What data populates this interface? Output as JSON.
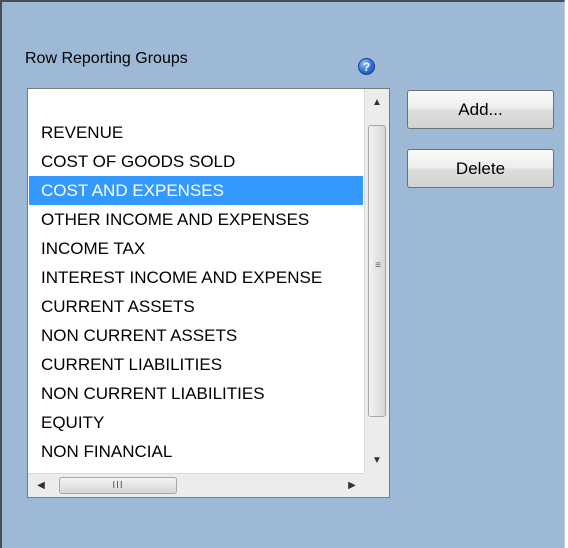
{
  "section": {
    "label": "Row Reporting Groups",
    "help_icon": "question-help-icon",
    "help_glyph": "?"
  },
  "list": {
    "items": [
      {
        "label": ""
      },
      {
        "label": "REVENUE"
      },
      {
        "label": "COST OF GOODS SOLD"
      },
      {
        "label": "COST AND EXPENSES",
        "selected": true
      },
      {
        "label": "OTHER INCOME AND EXPENSES"
      },
      {
        "label": "INCOME TAX"
      },
      {
        "label": "INTEREST INCOME AND EXPENSE"
      },
      {
        "label": "CURRENT ASSETS"
      },
      {
        "label": "NON CURRENT ASSETS"
      },
      {
        "label": "CURRENT LIABILITIES"
      },
      {
        "label": "NON CURRENT LIABILITIES"
      },
      {
        "label": "EQUITY"
      },
      {
        "label": "NON FINANCIAL"
      }
    ],
    "selected_color": "#3399ff"
  },
  "buttons": {
    "add_label": "Add...",
    "delete_label": "Delete"
  },
  "scrollbars": {
    "up_glyph": "▲",
    "down_glyph": "▼",
    "left_glyph": "◀",
    "right_glyph": "▶",
    "vgrip_glyph": "≡",
    "hgrip_glyph": "III"
  },
  "colors": {
    "panel_bg": "#9eb9d6",
    "selection": "#3399ff"
  }
}
